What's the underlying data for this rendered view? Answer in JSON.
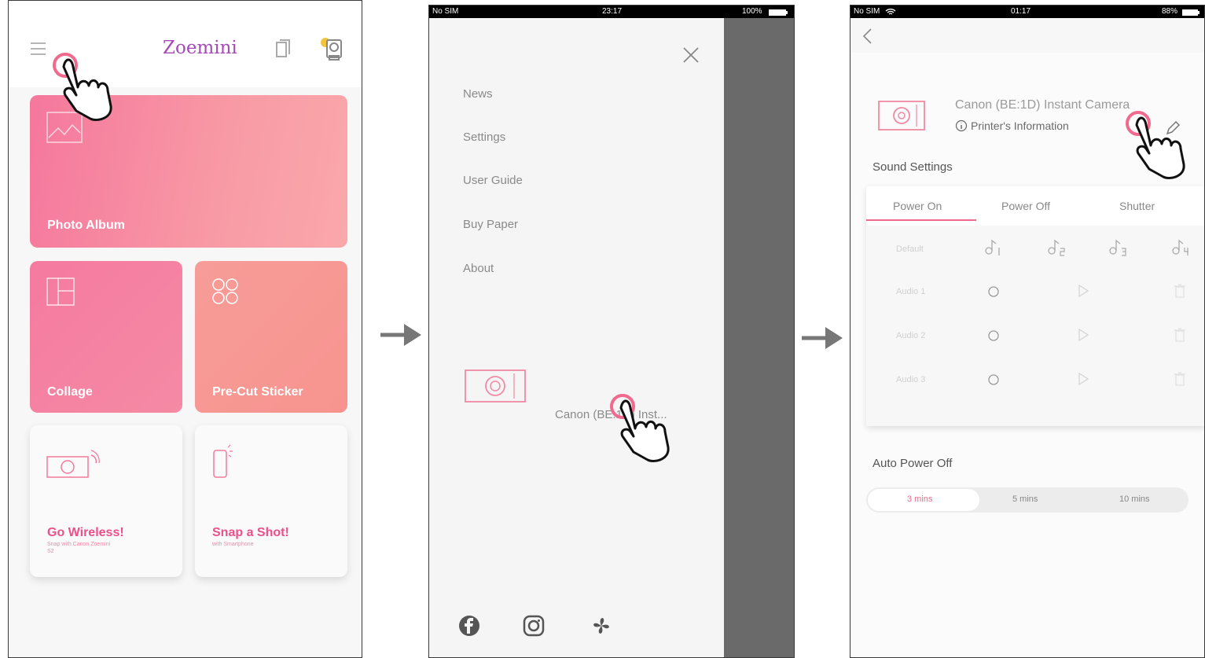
{
  "screen1": {
    "app_title": "Zoemini",
    "tiles": {
      "photo_album": "Photo Album",
      "collage": "Collage",
      "pre_cut_sticker": "Pre-Cut Sticker",
      "go_wireless": {
        "title": "Go Wireless!",
        "subtitle": "Snap with Canon Zoemini S2"
      },
      "snap_a_shot": {
        "title": "Snap a Shot!",
        "subtitle": "with Smartphone"
      }
    }
  },
  "screen2": {
    "status": {
      "carrier": "No SIM",
      "time": "23:17",
      "battery": "100%"
    },
    "menu": [
      "News",
      "Settings",
      "User Guide",
      "Buy Paper",
      "About"
    ],
    "device_label": "Canon (BE:1D) Inst..."
  },
  "screen3": {
    "status": {
      "carrier": "No SIM",
      "time": "01:17",
      "battery": "88%"
    },
    "device_name": "Canon (BE:1D) Instant Camera",
    "printer_info": "Printer's Information",
    "sound_settings_label": "Sound Settings",
    "sound_tabs": [
      "Power On",
      "Power Off",
      "Shutter"
    ],
    "sound_rows": [
      "Default",
      "Audio 1",
      "Audio 2",
      "Audio 3"
    ],
    "auto_power_off_label": "Auto Power Off",
    "auto_power_off_options": [
      "3 mins",
      "5 mins",
      "10 mins"
    ],
    "auto_power_off_selected": "3 mins"
  },
  "colors": {
    "brand": "#a54bb8",
    "accent": "#f06a8e",
    "tile_pink": "#f57aa0",
    "tile_coral": "#f7948f"
  }
}
